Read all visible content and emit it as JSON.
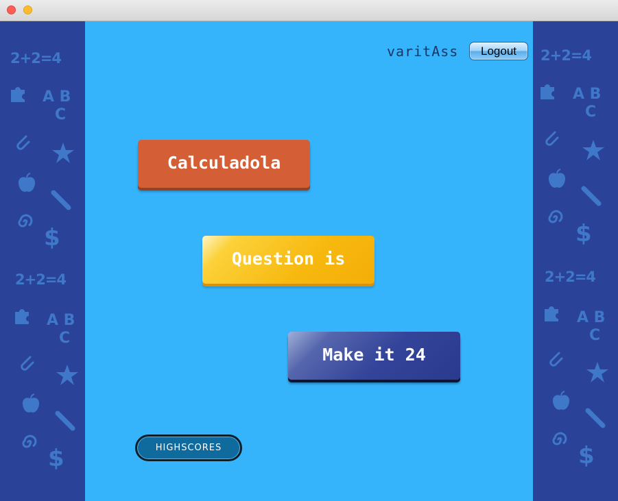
{
  "window": {
    "controls": [
      "close",
      "minimize"
    ]
  },
  "header": {
    "username": "varitAss",
    "logout_label": "Logout"
  },
  "menu": {
    "calculadola_label": "Calculadola",
    "question_label": "Question is",
    "make24_label": "Make it 24",
    "highscores_label": "HIGHSCORES"
  },
  "decor": {
    "equation": "2+2=4",
    "abc_top": "A B",
    "abc_bottom": "C",
    "dollar": "$",
    "spiral": "@",
    "icons": [
      "puzzle-icon",
      "paperclip-icon",
      "star-icon",
      "apple-icon",
      "pencil-icon",
      "spiral-icon",
      "dollar-icon"
    ]
  },
  "colors": {
    "background": "#35b4fc",
    "side_panel": "#2b4299",
    "doodle": "#3f77c9",
    "calculadola_button": "#d45f36",
    "question_button": "#f7b90f",
    "make24_button": "#33449a",
    "highscores_button": "#0f6a9d"
  }
}
